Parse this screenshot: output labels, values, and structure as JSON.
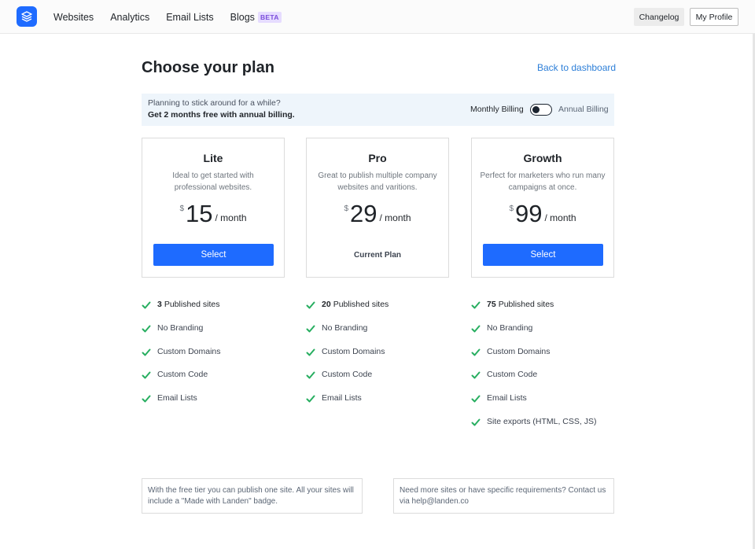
{
  "nav": {
    "items": [
      {
        "label": "Websites"
      },
      {
        "label": "Analytics"
      },
      {
        "label": "Email Lists"
      },
      {
        "label": "Blogs",
        "badge": "BETA"
      }
    ],
    "changelog": "Changelog",
    "profile": "My Profile"
  },
  "header": {
    "title": "Choose your plan",
    "back_link": "Back to dashboard"
  },
  "banner": {
    "line1": "Planning to stick around for a while?",
    "line2": "Get 2 months free with annual billing.",
    "monthly_label": "Monthly Billing",
    "annual_label": "Annual Billing",
    "annual_enabled": false
  },
  "plans": [
    {
      "name": "Lite",
      "description": "Ideal to get started with professional websites.",
      "currency": "$",
      "price": "15",
      "period": "/ month",
      "action": "Select",
      "features": [
        {
          "count": "3",
          "text": "Published sites"
        },
        {
          "text": "No Branding"
        },
        {
          "text": "Custom Domains"
        },
        {
          "text": "Custom Code"
        },
        {
          "text": "Email Lists"
        }
      ]
    },
    {
      "name": "Pro",
      "description": "Great to publish multiple company websites and varitions.",
      "currency": "$",
      "price": "29",
      "period": "/ month",
      "current_label": "Current Plan",
      "features": [
        {
          "count": "20",
          "text": "Published sites"
        },
        {
          "text": "No Branding"
        },
        {
          "text": "Custom Domains"
        },
        {
          "text": "Custom Code"
        },
        {
          "text": "Email Lists"
        }
      ]
    },
    {
      "name": "Growth",
      "description": "Perfect for marketers who run many campaigns at once.",
      "currency": "$",
      "price": "99",
      "period": "/ month",
      "action": "Select",
      "features": [
        {
          "count": "75",
          "text": "Published sites"
        },
        {
          "text": "No Branding"
        },
        {
          "text": "Custom Domains"
        },
        {
          "text": "Custom Code"
        },
        {
          "text": "Email Lists"
        },
        {
          "text": "Site exports (HTML, CSS, JS)"
        }
      ]
    }
  ],
  "notes": {
    "free_tier": "With the free tier you can publish one site. All your sites will include a \"Made with Landen\" badge.",
    "contact": "Need more sites or have specific requirements? Contact us via help@landen.co"
  },
  "colors": {
    "primary": "#1e6bff",
    "link": "#2d7fd8",
    "check": "#27ae60",
    "banner_bg": "#eef5fb",
    "beta_bg": "#e6dcff",
    "beta_text": "#7b4ddb"
  },
  "icons": {
    "logo": "layers-icon",
    "feature": "check-icon"
  }
}
